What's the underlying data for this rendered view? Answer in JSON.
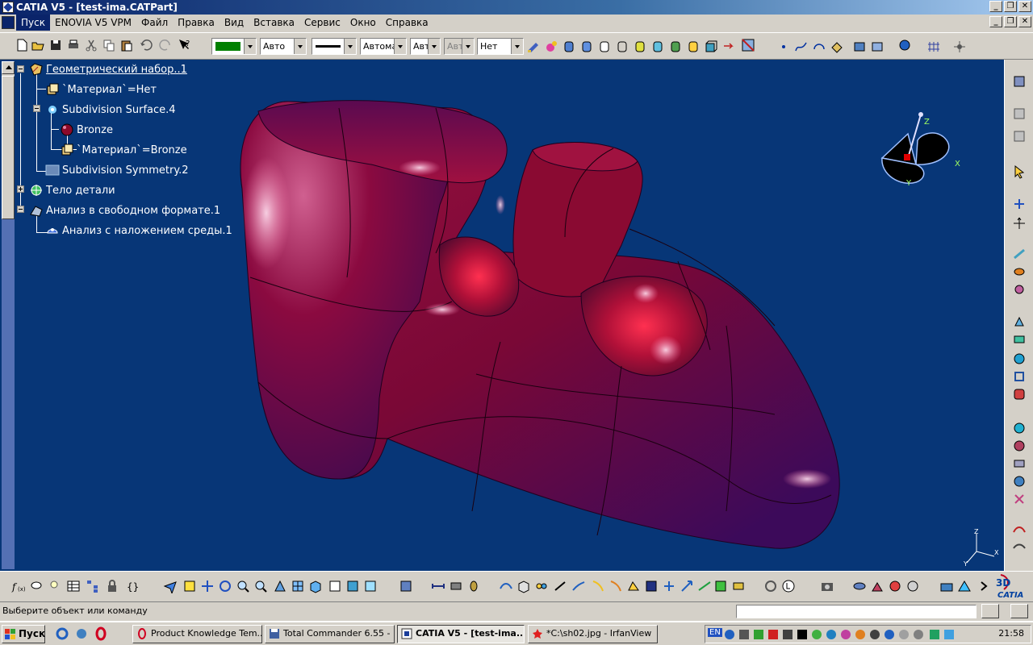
{
  "window": {
    "title": "CATIA V5 - [test-ima.CATPart]",
    "controls": [
      "_",
      "❐",
      "✕"
    ]
  },
  "menu": {
    "items": [
      "Пуск",
      "ENOVIA V5 VPM",
      "Файл",
      "Правка",
      "Вид",
      "Вставка",
      "Сервис",
      "Окно",
      "Справка"
    ]
  },
  "toolbar": {
    "fill_color": "#008000",
    "combo_auto": "Авто",
    "combo_automat": "Автома",
    "combo_aut": "Авт",
    "combo_aut_disabled": "Авт",
    "combo_none": "Нет"
  },
  "tree": {
    "root": "Геометрический набор..1",
    "material_none": "`Материал`=Нет",
    "subdivision_surface": "Subdivision Surface.4",
    "bronze": "Bronze",
    "material_bronze": "`Материал`=Bronze",
    "subdivision_symmetry": "Subdivision Symmetry.2",
    "part_body": "Тело детали",
    "freeform_analysis": "Анализ в свободном формате.1",
    "environment_mapping": "Анализ с наложением среды.1"
  },
  "compass": {
    "z": "Z",
    "x": "X",
    "y": "Y"
  },
  "axis": {
    "z": "Z",
    "x": "X",
    "y": "Y"
  },
  "status": {
    "prompt": "Выберите объект или команду"
  },
  "brand": {
    "logo_text": "CATIA"
  },
  "taskbar": {
    "start": "Пуск",
    "tasks": [
      "Product Knowledge Tem...",
      "Total Commander 6.55 - ...",
      "CATIA V5 - [test-ima...",
      "*C:\\sh02.jpg - IrfanView"
    ],
    "clock": "21:58",
    "lang": "EN"
  },
  "colors": {
    "viewport_bg": "#073677",
    "part_color": "#8b0a2a",
    "accent": "#0a246a"
  }
}
